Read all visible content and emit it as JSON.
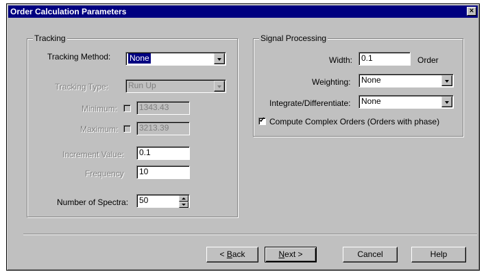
{
  "window": {
    "title": "Order Calculation Parameters",
    "close_glyph": "×"
  },
  "tracking": {
    "group_title": "Tracking",
    "tracking_method_label": "Tracking Method:",
    "tracking_method_value": "None",
    "tracking_type_label": "Tracking Type:",
    "tracking_type_value": "Run Up",
    "minimum_label": "Minimum:",
    "minimum_value": "1343.43",
    "maximum_label": "Maximum:",
    "maximum_value": "3213.39",
    "increment_label": "Increment Value:",
    "increment_value": "0.1",
    "frequency_label": "Frequency",
    "frequency_value": "10",
    "num_spectra_label": "Number of Spectra:",
    "num_spectra_value": "50"
  },
  "signal": {
    "group_title": "Signal Processing",
    "width_label": "Width:",
    "width_value": "0.1",
    "width_unit": "Order",
    "weighting_label": "Weighting:",
    "weighting_value": "None",
    "integrate_label": "Integrate/Differentiate:",
    "integrate_value": "None",
    "complex_label": "Compute Complex Orders (Orders with phase)",
    "complex_checked": true
  },
  "buttons": {
    "back_prefix": "< ",
    "back_hot": "B",
    "back_rest": "ack",
    "next_hot": "N",
    "next_rest": "ext >",
    "cancel": "Cancel",
    "help": "Help"
  }
}
